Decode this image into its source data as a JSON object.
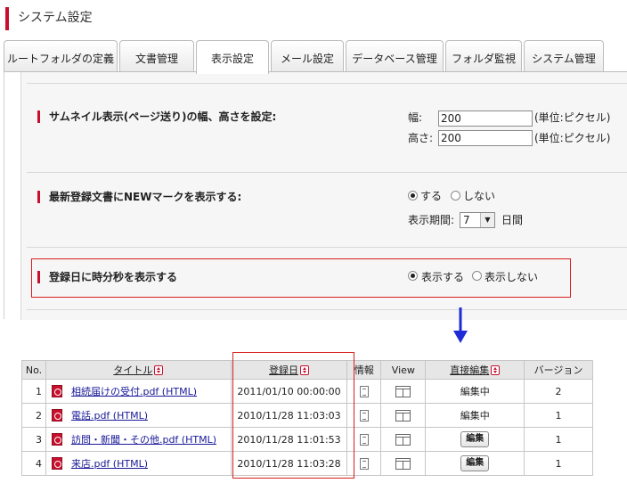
{
  "header": {
    "title": "システム設定"
  },
  "tabs": [
    {
      "label": "ルートフォルダの定義",
      "active": false
    },
    {
      "label": "文書管理",
      "active": false
    },
    {
      "label": "表示設定",
      "active": true
    },
    {
      "label": "メール設定",
      "active": false
    },
    {
      "label": "データベース管理",
      "active": false
    },
    {
      "label": "フォルダ監視",
      "active": false
    },
    {
      "label": "システム管理",
      "active": false
    }
  ],
  "settings": {
    "thumbnail": {
      "label": "サムネイル表示(ページ送り)の幅、高さを設定:",
      "width_label": "幅:",
      "width_value": "200",
      "height_label": "高さ:",
      "height_value": "200",
      "unit": "(単位:ピクセル)"
    },
    "newmark": {
      "label": "最新登録文書にNEWマークを表示する:",
      "option_yes": "する",
      "option_no": "しない",
      "selected": "する",
      "period_label": "表示期間:",
      "period_value": "7",
      "period_unit": "日間"
    },
    "datetime": {
      "label": "登録日に時分秒を表示する",
      "option_yes": "表示する",
      "option_no": "表示しない",
      "selected": "表示する"
    }
  },
  "table": {
    "headers": {
      "no": "No.",
      "title": "タイトル",
      "date": "登録日",
      "info": "情報",
      "view": "View",
      "edit": "直接編集",
      "version": "バージョン"
    },
    "rows": [
      {
        "no": "1",
        "title": "相続届けの受付.pdf (HTML)",
        "date": "2011/01/10 00:00:00",
        "edit": "編集中",
        "edit_is_button": false,
        "version": "2"
      },
      {
        "no": "2",
        "title": "電話.pdf (HTML)",
        "date": "2010/11/28 11:03:03",
        "edit": "編集中",
        "edit_is_button": false,
        "version": "1"
      },
      {
        "no": "3",
        "title": "訪問・新聞・その他.pdf (HTML)",
        "date": "2010/11/28 11:01:53",
        "edit": "編集",
        "edit_is_button": true,
        "version": "1"
      },
      {
        "no": "4",
        "title": "来店.pdf (HTML)",
        "date": "2010/11/28 11:03:28",
        "edit": "編集",
        "edit_is_button": true,
        "version": "1"
      }
    ]
  },
  "colors": {
    "accent": "#c8102e",
    "arrow": "#1f2bd6",
    "highlight": "#d81e1e"
  }
}
